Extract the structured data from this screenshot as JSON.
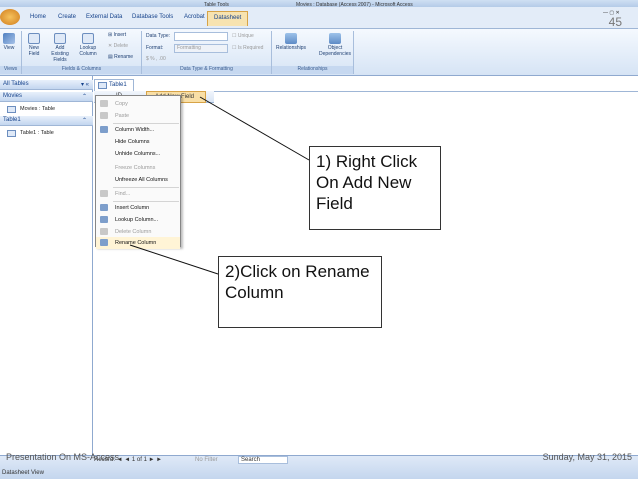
{
  "window": {
    "title": "Movies : Database (Access 2007) - Microsoft Access",
    "context_tab": "Table Tools"
  },
  "ribbon_tabs": [
    "Home",
    "Create",
    "External Data",
    "Database Tools",
    "Acrobat",
    "Datasheet"
  ],
  "ribbon": {
    "groups": {
      "views": "Views",
      "fields_columns": "Fields & Columns",
      "data_type": "Data Type & Formatting",
      "relationships": "Relationships"
    },
    "buttons": {
      "view": "View",
      "new_field": "New Field",
      "add_existing": "Add Existing Fields",
      "lookup": "Lookup Column",
      "insert": "Insert",
      "delete": "Delete",
      "rename": "Rename",
      "data_type": "Data Type:",
      "format": "Format:",
      "format_value": "Formatting",
      "unique": "Unique",
      "is_required": "Is Required",
      "relationships": "Relationships",
      "object_dependencies": "Object Dependencies"
    }
  },
  "slide": {
    "page_number": "45",
    "footer_left": "Presentation On MS-Access",
    "footer_right": "Sunday, May 31, 2015"
  },
  "nav_pane": {
    "header": "All Tables",
    "groups": [
      {
        "name": "Movies",
        "items": [
          "Movies : Table"
        ]
      },
      {
        "name": "Table1",
        "items": [
          "Table1 : Table"
        ]
      }
    ]
  },
  "datasheet": {
    "tab": "Table1",
    "id_header": "ID",
    "add_field_header": "Add New Field"
  },
  "context_menu": {
    "items": [
      {
        "label": "Copy",
        "disabled": true
      },
      {
        "label": "Paste",
        "disabled": true
      },
      {
        "label": "Column Width...",
        "disabled": false
      },
      {
        "label": "Hide Columns",
        "disabled": false
      },
      {
        "label": "Unhide Columns...",
        "disabled": false
      },
      {
        "label": "Freeze Columns",
        "disabled": true
      },
      {
        "label": "Unfreeze All Columns",
        "disabled": false
      },
      {
        "label": "Find...",
        "disabled": true
      },
      {
        "label": "Insert Column",
        "disabled": false
      },
      {
        "label": "Lookup Column...",
        "disabled": false
      },
      {
        "label": "Delete Column",
        "disabled": true
      },
      {
        "label": "Rename Column",
        "disabled": false
      }
    ]
  },
  "callouts": {
    "first": "1) Right Click On Add New Field",
    "second": "2)Click on Rename Column"
  },
  "record_nav": {
    "record": "1 of 1",
    "filter": "No Filter",
    "search": "Search"
  },
  "status": {
    "view": "Datasheet View"
  },
  "colors": {
    "accent": "#15428b",
    "ribbon_bg": "#d6e4f5",
    "highlight": "#f9dfa6"
  }
}
